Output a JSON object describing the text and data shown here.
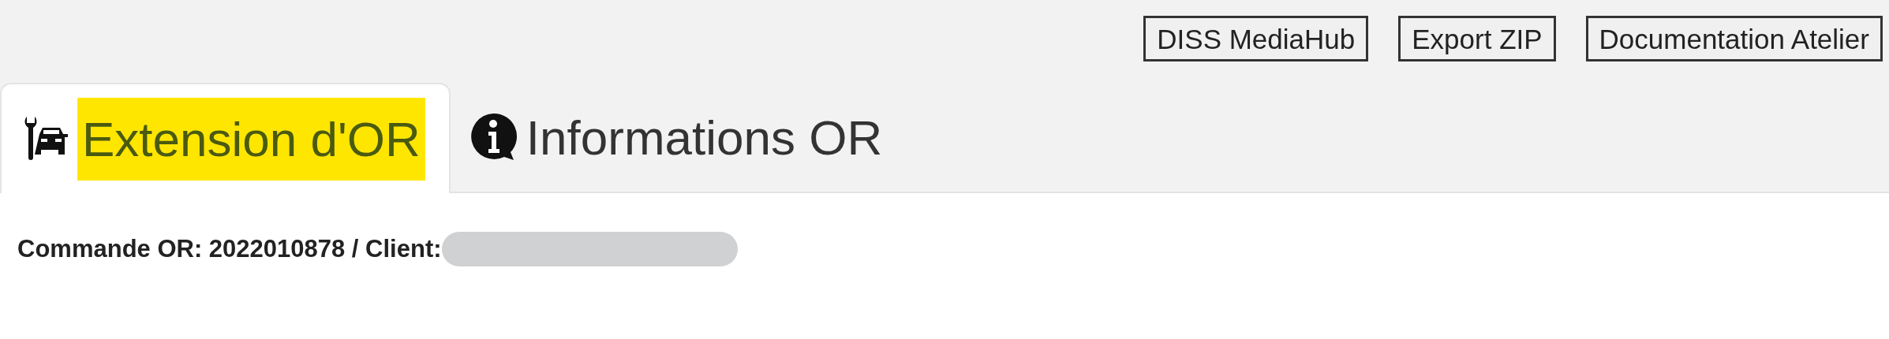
{
  "toolbar": {
    "buttons": [
      "DISS MediaHub",
      "Export ZIP",
      "Documentation Atelier"
    ]
  },
  "tabs": [
    {
      "label": "Extension d'OR",
      "selected": true,
      "highlighted": true,
      "kind": "repair"
    },
    {
      "label": "Informations OR",
      "selected": false,
      "highlighted": false,
      "kind": "info"
    }
  ],
  "header": {
    "text": "Commande OR: 2022010878 / Client:",
    "redacted": true
  }
}
